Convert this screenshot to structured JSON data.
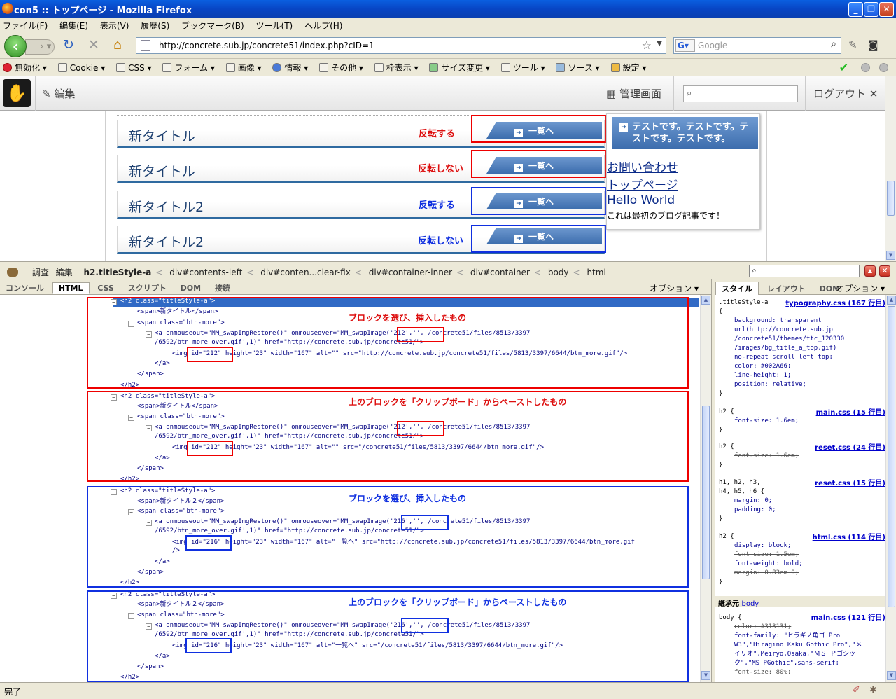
{
  "window": {
    "title": "con5 :: トップページ - Mozilla Firefox"
  },
  "menu": [
    "ファイル(F)",
    "編集(E)",
    "表示(V)",
    "履歴(S)",
    "ブックマーク(B)",
    "ツール(T)",
    "ヘルプ(H)"
  ],
  "nav": {
    "url": "http://concrete.sub.jp/concrete51/index.php?cID=1",
    "search_placeholder": "Google",
    "g_label": "G"
  },
  "devtoolbar": [
    "無効化",
    "Cookie",
    "CSS",
    "フォーム",
    "画像",
    "情報",
    "その他",
    "枠表示",
    "サイズ変更",
    "ツール",
    "ソース",
    "設定"
  ],
  "cms": {
    "edit": "編集",
    "dashboard": "管理画面",
    "logout": "ログアウト"
  },
  "page": {
    "blocks": [
      {
        "title": "新タイトル",
        "label": "反転する",
        "button": "一覧へ",
        "color": "#dd1010"
      },
      {
        "title": "新タイトル",
        "label": "反転しない",
        "button": "一覧へ",
        "color": "#dd1010"
      },
      {
        "title": "新タイトル2",
        "label": "反転する",
        "button": "一覧へ",
        "color": "#1030e0"
      },
      {
        "title": "新タイトル2",
        "label": "反転しない",
        "button": "一覧へ",
        "color": "#1030e0"
      }
    ],
    "sidebar": {
      "head": "テストです。テストです。テストです。テストです。",
      "links": [
        "お問い合わせ",
        "トップページ",
        "Hello World"
      ],
      "text": "これは最初のブログ記事です！"
    }
  },
  "firebug": {
    "toolbar": {
      "inspect": "調査",
      "edit": "編集",
      "breadcrumbs": [
        "h2.titleStyle-a",
        "div#contents-left",
        "div#conten...clear-fix",
        "div#container-inner",
        "div#container",
        "body",
        "html"
      ]
    },
    "tabs": [
      "コンソール",
      "HTML",
      "CSS",
      "スクリプト",
      "DOM",
      "接続"
    ],
    "options": "オプション",
    "side_tabs": [
      "スタイル",
      "レイアウト",
      "DOM"
    ],
    "annotations": {
      "a1": "ブロックを選び、挿入したもの",
      "a2": "上のブロックを「クリップボード」からペーストしたもの",
      "a3": "ブロックを選び、挿入したもの",
      "a4": "上のブロックを「クリップボード」からペーストしたもの"
    },
    "html_lines": {
      "h2open": "<h2 class=\"titleStyle-a\">",
      "span1": "<span>新タイトル</span>",
      "span1b": "<span>新タイトル２</span>",
      "spanbtn": "<span class=\"btn-more\">",
      "a212": "<a onmouseout=\"MM_swapImgRestore()\" onmouseover=\"MM_swapImage('212','','/concrete51/files/8513/3397",
      "a216": "<a onmouseout=\"MM_swapImgRestore()\" onmouseover=\"MM_swapImage('216','','/concrete51/files/8513/3397",
      "acont": "/6592/btn_more_over.gif',1)\" href=\"http://concrete.sub.jp/concrete51/\">",
      "img1": "<img id=\"212\" height=\"23\" width=\"167\" alt=\"\" src=\"http://concrete.sub.jp/concrete51/files/5813/3397/6644/btn_more.gif\"/>",
      "img2": "<img id=\"212\" height=\"23\" width=\"167\" alt=\"\" src=\"/concrete51/files/5813/3397/6644/btn_more.gif\"/>",
      "img3": "<img id=\"216\" height=\"23\" width=\"167\" alt=\"一覧へ\" src=\"http://concrete.sub.jp/concrete51/files/5813/3397/6644/btn_more.gif",
      "img3b": "/>",
      "img4": "<img id=\"216\" height=\"23\" width=\"167\" alt=\"一覧へ\" src=\"/concrete51/files/5813/3397/6644/btn_more.gif\"/>",
      "aclose": "</a>",
      "spanclose": "</span>",
      "h2close": "</h2>"
    },
    "css": {
      "r1sel": ".titleStyle-a",
      "r1src": "typography.css (167 行目)",
      "r1": [
        "background: transparent",
        "url(http://concrete.sub.jp",
        "/concrete51/themes/ttc_120330",
        "/images/bg_title_a_top.gif)",
        "no-repeat scroll left top;",
        "color: #002A66;",
        "line-height: 1;",
        "position: relative;"
      ],
      "r2sel": "h2 {",
      "r2src": "main.css (15 行目)",
      "r2": "font-size: 1.6em;",
      "r3sel": "h2 {",
      "r3src": "reset.css (24 行目)",
      "r3": "font-size: 1.6em;",
      "r4sel": "h1, h2, h3,",
      "r4sel2": "h4, h5, h6 {",
      "r4src": "reset.css (15 行目)",
      "r4": [
        "margin: 0;",
        "padding: 0;"
      ],
      "r5sel": "h2 {",
      "r5src": "html.css (114 行目)",
      "r5": [
        "display: block;",
        "font-size: 1.5em;",
        "font-weight: bold;",
        "margin: 0.83em 0;"
      ],
      "inherit": "継承元",
      "inherit_from": "body",
      "r6sel": "body {",
      "r6src": "main.css (121 行目)",
      "r6": [
        "color: #313131;",
        "font-family: \"ヒラギノ角ゴ Pro",
        "W3\",\"Hiragino Kaku Gothic Pro\",\"メ",
        "イリオ\",Meiryo,Osaka,\"ＭＳ Ｐゴシッ",
        "ク\",\"MS PGothic\",sans-serif;",
        "font-size: 80%;"
      ],
      "close": "}"
    }
  },
  "status": "完了"
}
